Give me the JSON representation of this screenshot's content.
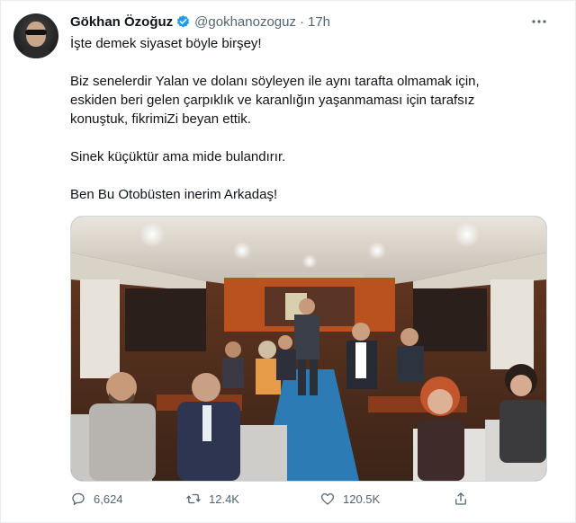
{
  "tweet": {
    "author_name": "Gökhan Özoğuz",
    "handle": "@gokhanozoguz",
    "separator": "·",
    "time": "17h",
    "lines": [
      "İşte demek siyaset böyle birşey!",
      "Biz senelerdir Yalan ve dolanı söyleyen  ile aynı tarafta olmamak için,",
      "eskiden beri gelen çarpıklık ve karanlığın yaşanmaması için tarafsız",
      "konuştuk, fikrimiZi beyan ettik.",
      "Sinek küçüktür ama mide bulandırır.",
      "Ben Bu Otobüsten inerim Arkadaş!"
    ],
    "metrics": {
      "replies": "6,624",
      "retweets": "12.4K",
      "likes": "120.5K"
    }
  },
  "icons": {
    "verified": "verified-badge-icon",
    "more": "more-icon",
    "reply": "reply-icon",
    "retweet": "retweet-icon",
    "like": "like-icon",
    "share": "share-icon"
  },
  "colors": {
    "verified": "#1d9bf0",
    "text": "#0f1419",
    "muted": "#536471",
    "border": "#e6ecf0"
  }
}
